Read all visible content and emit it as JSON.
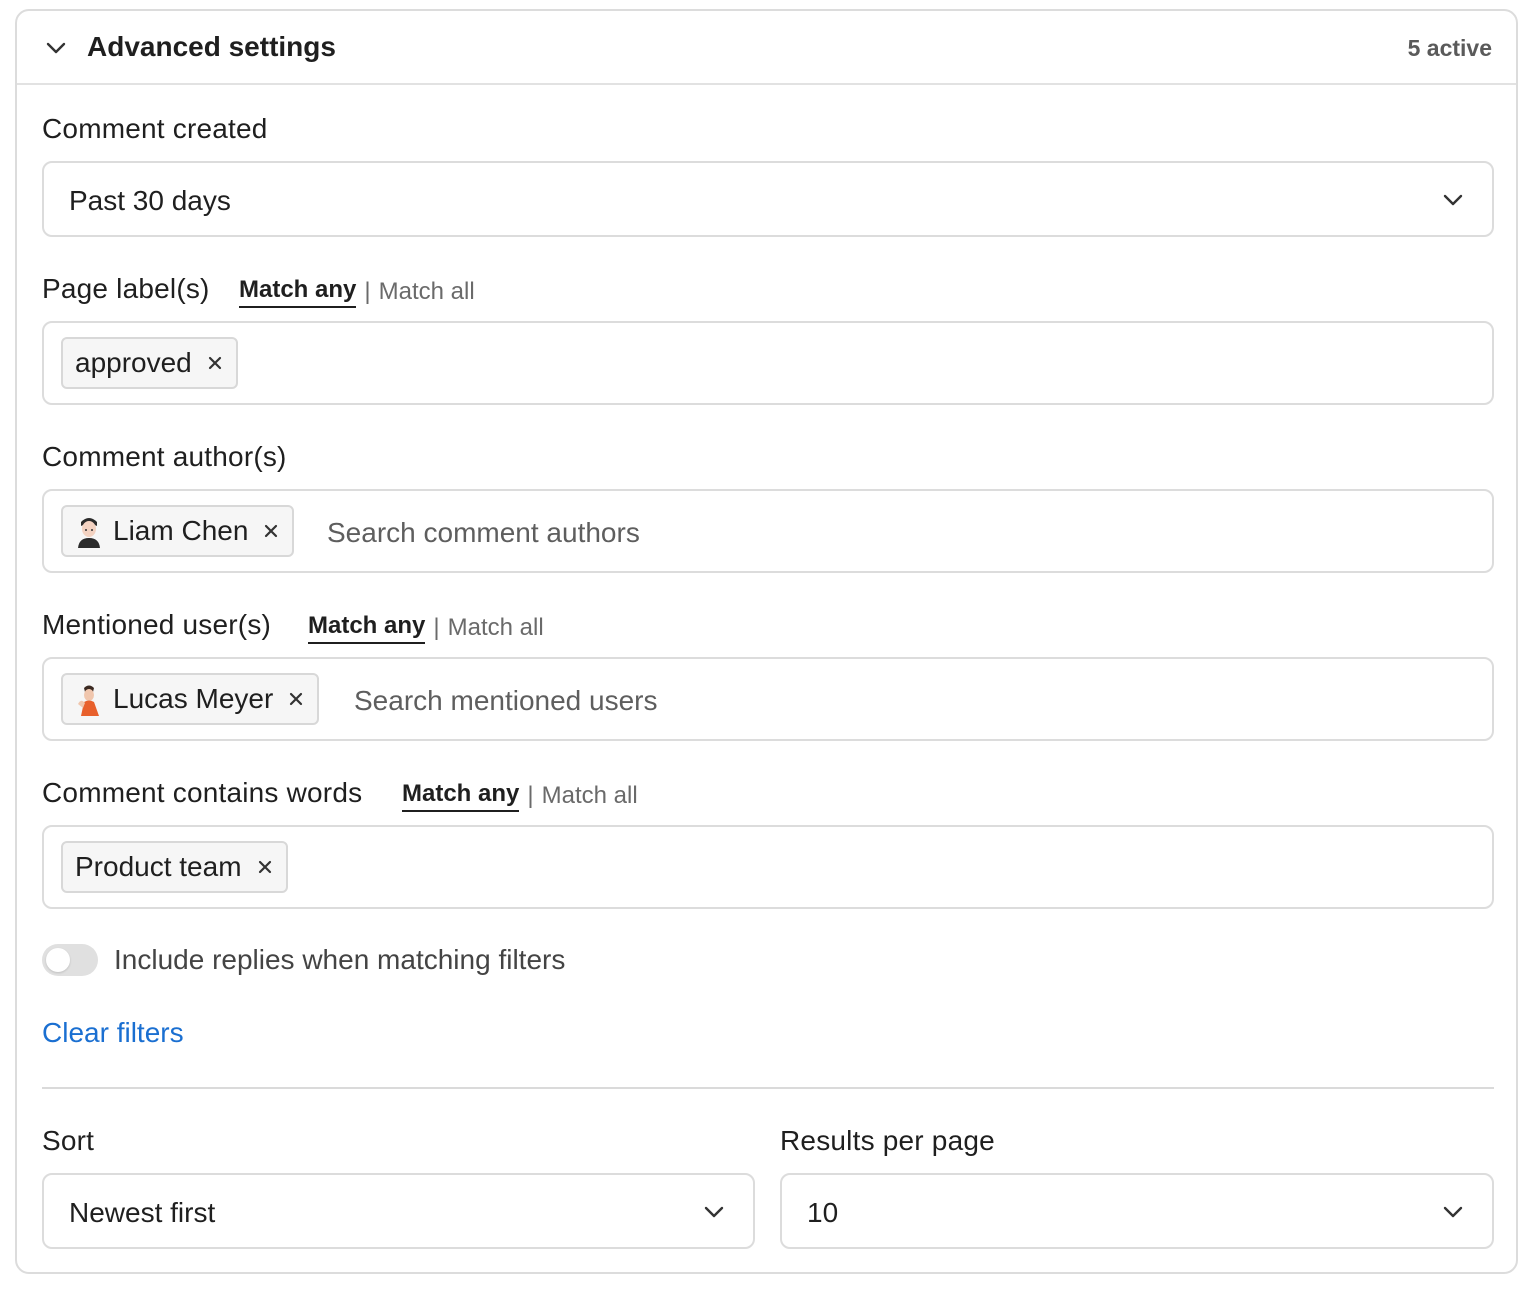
{
  "header": {
    "title": "Advanced settings",
    "active_count": "5 active"
  },
  "comment_created": {
    "label": "Comment created",
    "value": "Past 30 days"
  },
  "page_labels": {
    "label": "Page label(s)",
    "match_any": "Match any",
    "separator": "|",
    "match_all": "Match all",
    "chips": [
      {
        "text": "approved"
      }
    ]
  },
  "comment_authors": {
    "label": "Comment author(s)",
    "chips": [
      {
        "text": "Liam Chen"
      }
    ],
    "placeholder": "Search comment authors"
  },
  "mentioned_users": {
    "label": "Mentioned user(s)",
    "match_any": "Match any",
    "separator": "|",
    "match_all": "Match all",
    "chips": [
      {
        "text": "Lucas Meyer"
      }
    ],
    "placeholder": "Search mentioned users"
  },
  "comment_words": {
    "label": "Comment contains words",
    "match_any": "Match any",
    "separator": "|",
    "match_all": "Match all",
    "chips": [
      {
        "text": "Product team"
      }
    ]
  },
  "include_replies": {
    "label": "Include replies when matching filters",
    "on": false
  },
  "clear_filters": "Clear filters",
  "sort": {
    "label": "Sort",
    "value": "Newest first"
  },
  "results_per_page": {
    "label": "Results per page",
    "value": "10"
  },
  "colors": {
    "link": "#1a6fd1",
    "border": "#dcdcdc",
    "chip_bg": "#f6f6f6"
  }
}
